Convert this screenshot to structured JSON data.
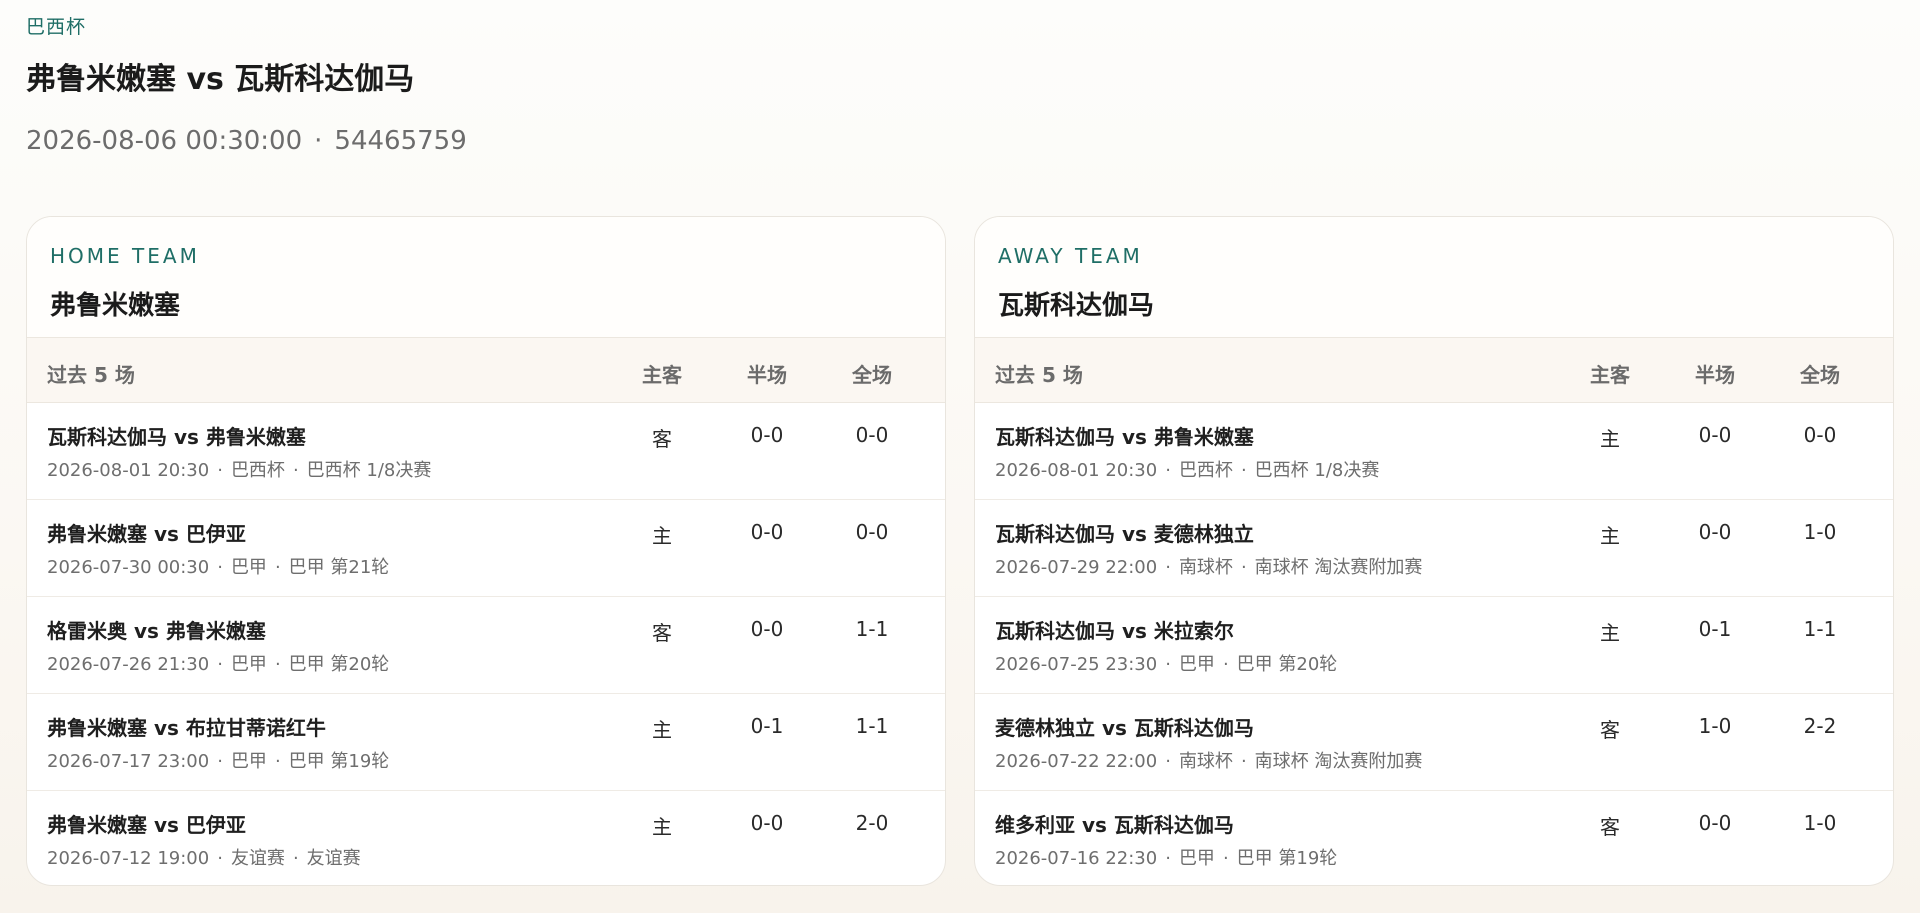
{
  "header": {
    "competition": "巴西杯",
    "title": "弗鲁米嫩塞 vs 瓦斯科达伽马",
    "datetime": "2026-08-06 00:30:00",
    "separator": "·",
    "match_id": "54465759"
  },
  "home": {
    "kicker": "HOME TEAM",
    "team": "弗鲁米嫩塞",
    "table_head": {
      "label": "过去 5 场",
      "side": "主客",
      "half": "半场",
      "full": "全场"
    },
    "rows": [
      {
        "teams": "瓦斯科达伽马 vs 弗鲁米嫩塞",
        "date": "2026-08-01 20:30",
        "comp": "巴西杯",
        "stage": "巴西杯 1/8决赛",
        "side": "客",
        "half": "0-0",
        "full": "0-0"
      },
      {
        "teams": "弗鲁米嫩塞 vs 巴伊亚",
        "date": "2026-07-30 00:30",
        "comp": "巴甲",
        "stage": "巴甲 第21轮",
        "side": "主",
        "half": "0-0",
        "full": "0-0"
      },
      {
        "teams": "格雷米奥 vs 弗鲁米嫩塞",
        "date": "2026-07-26 21:30",
        "comp": "巴甲",
        "stage": "巴甲 第20轮",
        "side": "客",
        "half": "0-0",
        "full": "1-1"
      },
      {
        "teams": "弗鲁米嫩塞 vs 布拉甘蒂诺红牛",
        "date": "2026-07-17 23:00",
        "comp": "巴甲",
        "stage": "巴甲 第19轮",
        "side": "主",
        "half": "0-1",
        "full": "1-1"
      },
      {
        "teams": "弗鲁米嫩塞 vs 巴伊亚",
        "date": "2026-07-12 19:00",
        "comp": "友谊赛",
        "stage": "友谊赛",
        "side": "主",
        "half": "0-0",
        "full": "2-0"
      }
    ]
  },
  "away": {
    "kicker": "AWAY TEAM",
    "team": "瓦斯科达伽马",
    "table_head": {
      "label": "过去 5 场",
      "side": "主客",
      "half": "半场",
      "full": "全场"
    },
    "rows": [
      {
        "teams": "瓦斯科达伽马 vs 弗鲁米嫩塞",
        "date": "2026-08-01 20:30",
        "comp": "巴西杯",
        "stage": "巴西杯 1/8决赛",
        "side": "主",
        "half": "0-0",
        "full": "0-0"
      },
      {
        "teams": "瓦斯科达伽马 vs 麦德林独立",
        "date": "2026-07-29 22:00",
        "comp": "南球杯",
        "stage": "南球杯 淘汰赛附加赛",
        "side": "主",
        "half": "0-0",
        "full": "1-0"
      },
      {
        "teams": "瓦斯科达伽马 vs 米拉索尔",
        "date": "2026-07-25 23:30",
        "comp": "巴甲",
        "stage": "巴甲 第20轮",
        "side": "主",
        "half": "0-1",
        "full": "1-1"
      },
      {
        "teams": "麦德林独立 vs 瓦斯科达伽马",
        "date": "2026-07-22 22:00",
        "comp": "南球杯",
        "stage": "南球杯 淘汰赛附加赛",
        "side": "客",
        "half": "1-0",
        "full": "2-2"
      },
      {
        "teams": "维多利亚 vs 瓦斯科达伽马",
        "date": "2026-07-16 22:30",
        "comp": "巴甲",
        "stage": "巴甲 第19轮",
        "side": "客",
        "half": "0-0",
        "full": "1-0"
      }
    ]
  }
}
